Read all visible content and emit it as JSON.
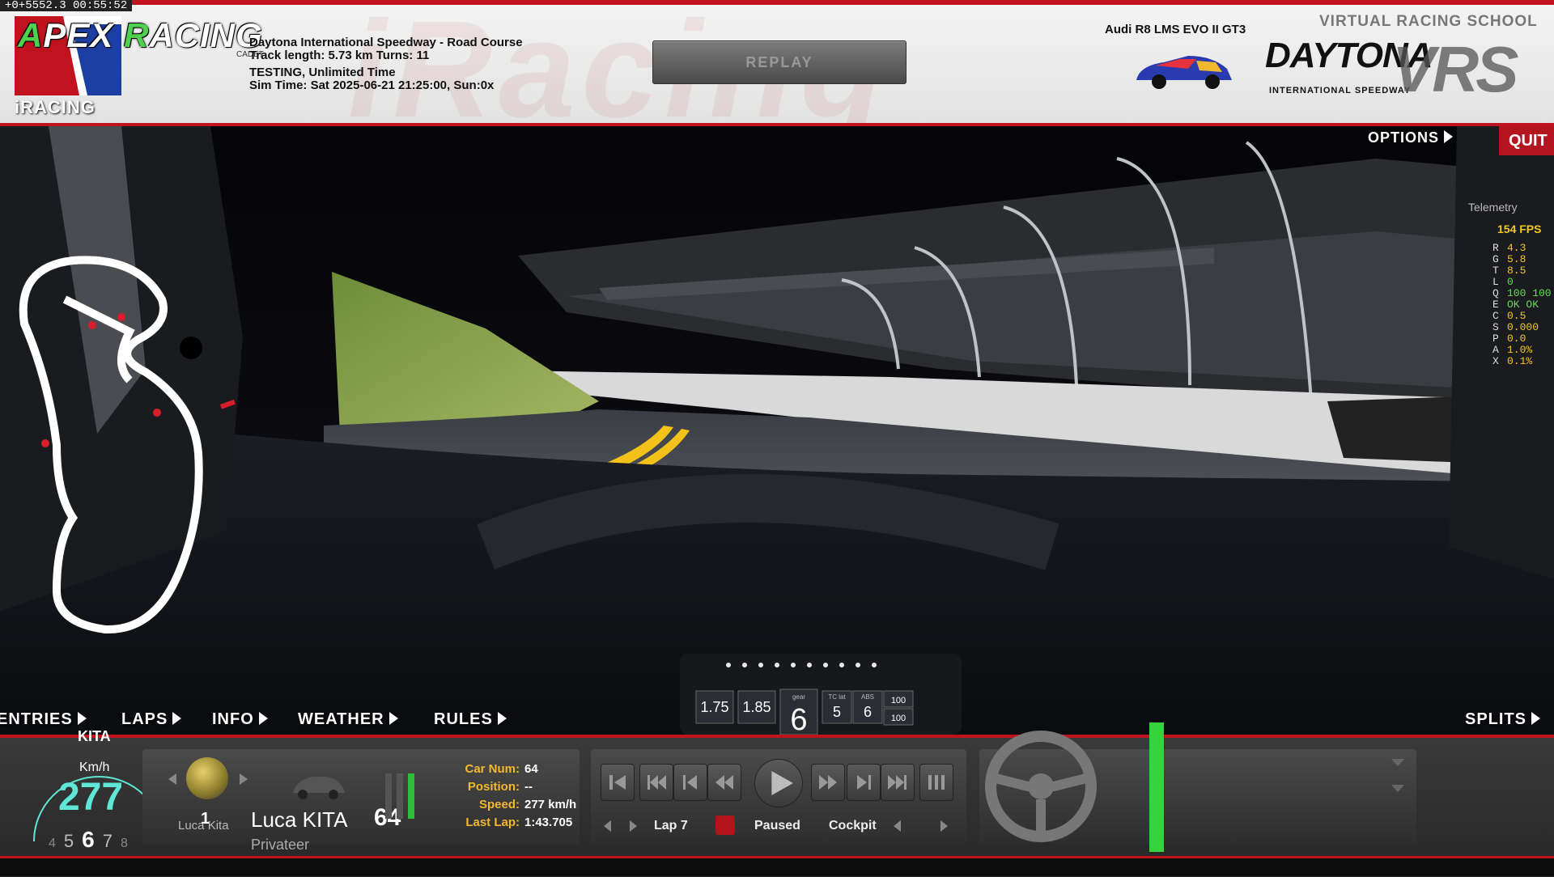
{
  "timestamp": "+0+5552.3 00:55:52",
  "header": {
    "brand_prefix_a": "A",
    "brand_mid": "PEX ",
    "brand_prefix_r": "R",
    "brand_suffix": "ACING",
    "platform": "iRACING",
    "cadet": "CADET",
    "track_name": "Daytona International Speedway - Road Course",
    "track_length": "Track length: 5.73 km Turns: 11",
    "session_type": "TESTING, Unlimited Time",
    "sim_time": "Sim Time: Sat 2025-06-21 21:25:00, Sun:0x",
    "replay_button": "REPLAY",
    "car_name": "Audi R8 LMS EVO II GT3",
    "school_label": "VIRTUAL RACING SCHOOL",
    "daytona_logo": "DAYTONA",
    "daytona_sub": "INTERNATIONAL SPEEDWAY",
    "vrs_logo": "VRS"
  },
  "top_right": {
    "options_label": "OPTIONS",
    "quit_label": "QUIT"
  },
  "telemetry": {
    "title": "Telemetry",
    "fps": "154 FPS",
    "rows": [
      {
        "k": "R",
        "v": "4.3"
      },
      {
        "k": "G",
        "v": "5.8"
      },
      {
        "k": "T",
        "v": "8.5"
      },
      {
        "k": "L",
        "v": "0"
      },
      {
        "k": "Q",
        "v": "100 100"
      },
      {
        "k": "E",
        "v": "OK  OK"
      },
      {
        "k": "C",
        "v": "0.5"
      },
      {
        "k": "S",
        "v": "0.000"
      },
      {
        "k": "P",
        "v": "0.0"
      },
      {
        "k": "A",
        "v": "1.0%"
      },
      {
        "k": "X",
        "v": "0.1%"
      }
    ]
  },
  "menu": {
    "entries": "ENTRIES",
    "laps": "LAPS",
    "info": "INFO",
    "weather": "WEATHER",
    "rules": "RULES",
    "splits": "SPLITS"
  },
  "dash": {
    "val1": "1.75",
    "val2": "1.85",
    "gear_label": "gear",
    "gear": "6",
    "tc_label": "TC lat",
    "tc": "5",
    "abs_label": "ABS",
    "abs": "6",
    "r1": "100",
    "r2": "100"
  },
  "driver": {
    "short_label": "KITA",
    "speed_unit": "Km/h",
    "speed": "277",
    "gears": [
      "4",
      "5",
      "6",
      "7",
      "8"
    ],
    "current_gear_index": 2,
    "position": "1",
    "short_name": "Luca Kita",
    "full_name": "Luca KITA",
    "team": "Privateer",
    "car_number": "64"
  },
  "stats": {
    "car_num_label": "Car Num:",
    "car_num": "64",
    "position_label": "Position:",
    "position": "--",
    "speed_label": "Speed:",
    "speed": "277 km/h",
    "last_lap_label": "Last Lap:",
    "last_lap": "1:43.705"
  },
  "replay": {
    "lap": "Lap 7",
    "state": "Paused",
    "camera": "Cockpit"
  },
  "colors": {
    "accent_red": "#c1121f",
    "speed_cyan": "#5fe6d6",
    "label_gold": "#f3b82d",
    "throttle_green": "#35d43a"
  },
  "icons": [
    "play-icon",
    "rewind-icon",
    "fast-forward-icon",
    "skip-back-icon",
    "skip-forward-icon",
    "step-back-icon",
    "step-forward-icon",
    "slow-motion-icon",
    "pause-indicator-icon",
    "steering-wheel-icon"
  ]
}
